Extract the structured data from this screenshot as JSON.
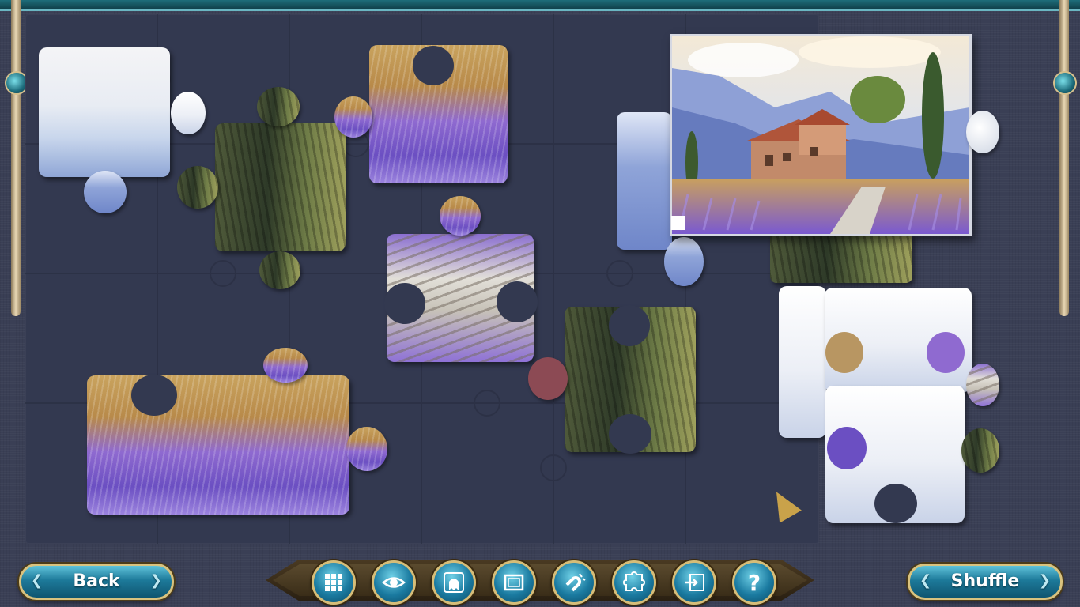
{
  "controls": {
    "back_label": "Back",
    "shuffle_label": "Shuffle"
  },
  "toolbar": {
    "tools": [
      {
        "name": "grid-icon"
      },
      {
        "name": "eye-icon"
      },
      {
        "name": "ghost-icon"
      },
      {
        "name": "frame-icon"
      },
      {
        "name": "magnet-icon"
      },
      {
        "name": "puzzle-icon"
      },
      {
        "name": "screen-exit-icon"
      },
      {
        "name": "help-icon",
        "glyph": "?"
      }
    ]
  },
  "colors": {
    "board": "#333950",
    "accent_teal": "#1d7a9a",
    "gold_trim": "#d9c27e",
    "lavender": "#8f6ad0"
  }
}
